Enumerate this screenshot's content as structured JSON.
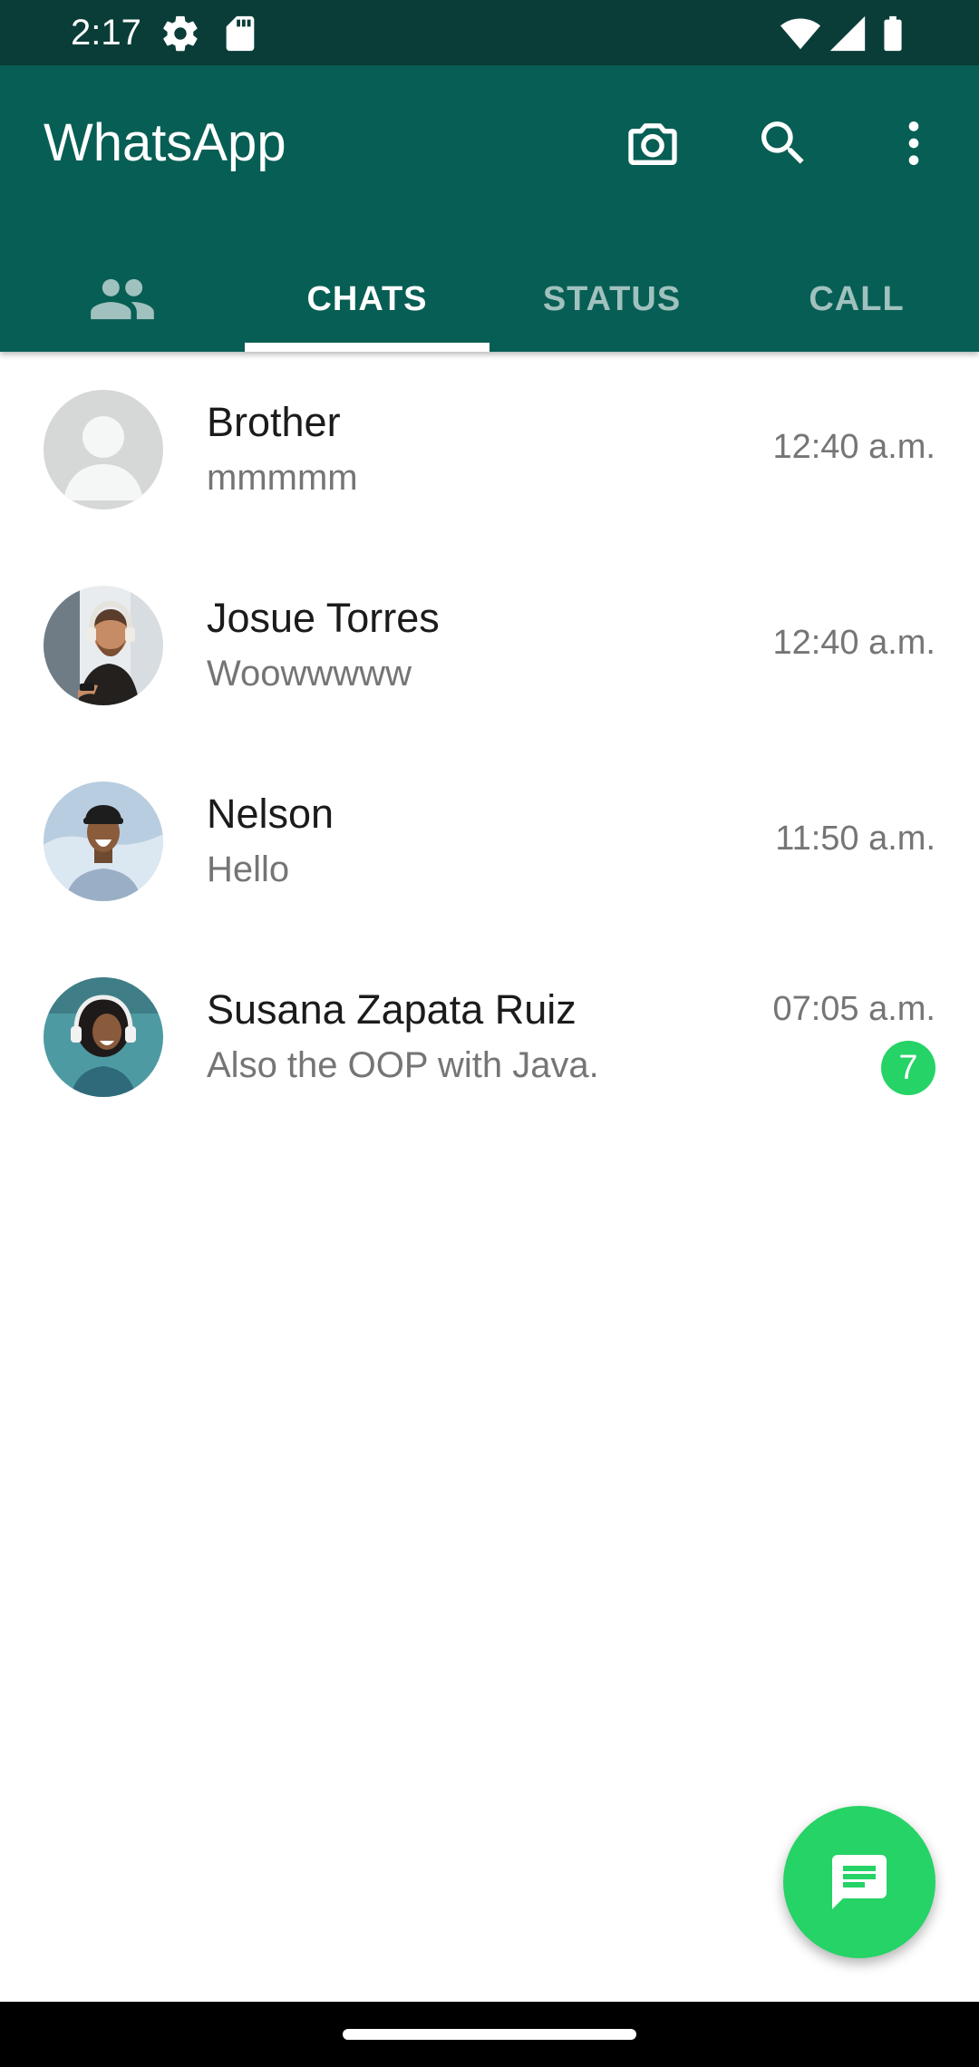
{
  "status_bar": {
    "time": "2:17",
    "icons": [
      "settings-icon",
      "sd-card-icon",
      "wifi-icon",
      "signal-icon",
      "battery-icon"
    ]
  },
  "app_bar": {
    "title": "WhatsApp",
    "actions": [
      "camera-icon",
      "search-icon",
      "more-vert-icon"
    ]
  },
  "tabs": {
    "community_icon": "community-icon",
    "items": [
      {
        "label": "CHATS",
        "active": true
      },
      {
        "label": "STATUS",
        "active": false
      },
      {
        "label": "CALL",
        "active": false
      }
    ]
  },
  "chats": [
    {
      "name": "Brother",
      "preview": "mmmmm",
      "time": "12:40 a.m."
    },
    {
      "name": "Josue Torres",
      "preview": "Woowwwww",
      "time": "12:40 a.m."
    },
    {
      "name": "Nelson",
      "preview": "Hello",
      "time": "11:50 a.m."
    },
    {
      "name": "Susana Zapata Ruiz",
      "preview": "Also the OOP with Java.",
      "time": "07:05 a.m.",
      "unread": "7"
    }
  ],
  "fab": {
    "icon": "new-chat-icon"
  },
  "colors": {
    "primary": "#075e54",
    "status_bar": "#0a3d37",
    "accent": "#25d366"
  }
}
